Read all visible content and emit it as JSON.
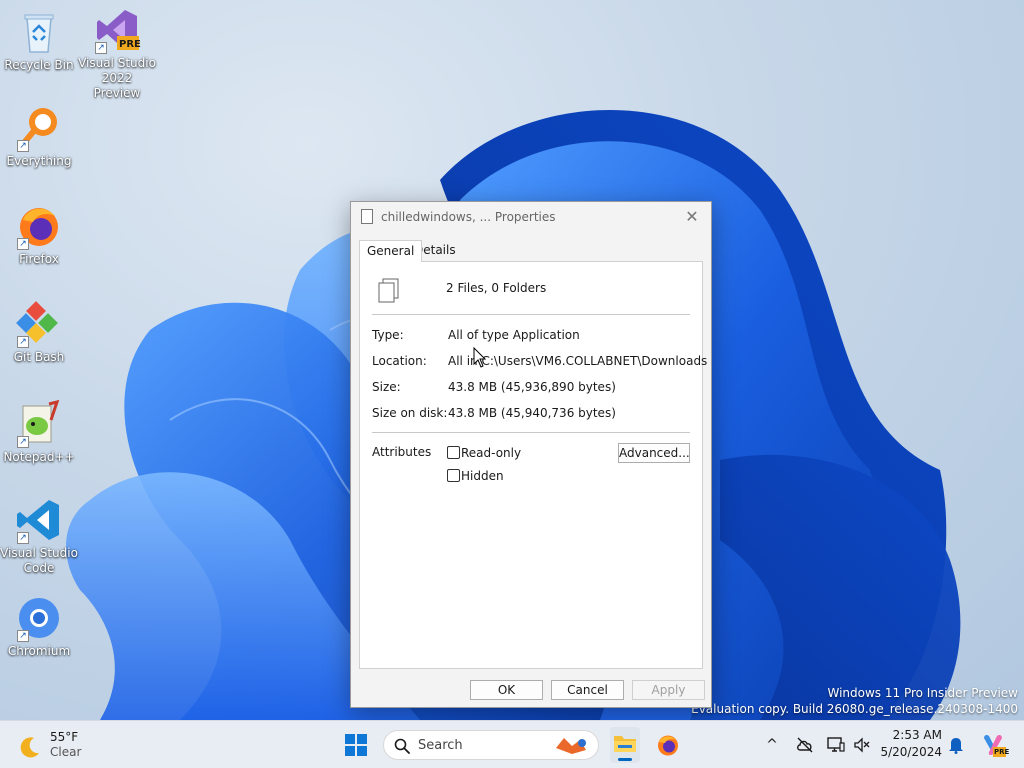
{
  "desktop": {
    "icons": [
      {
        "label": "Recycle Bin"
      },
      {
        "label": "Visual Studio 2022 Preview",
        "badge": "PRE"
      },
      {
        "label": "Everything"
      },
      {
        "label": "Firefox"
      },
      {
        "label": "Git Bash"
      },
      {
        "label": "Notepad++"
      },
      {
        "label": "Visual Studio Code"
      },
      {
        "label": "Chromium"
      }
    ],
    "watermark": {
      "line1": "Windows 11 Pro Insider Preview",
      "line2": "Evaluation copy. Build 26080.ge_release.240308-1400"
    }
  },
  "dialog": {
    "title": "chilledwindows, ... Properties",
    "close_symbol": "✕",
    "tabs": [
      {
        "label": "General"
      },
      {
        "label": "Details"
      }
    ],
    "active_tab": "General",
    "summary": "2 Files, 0 Folders",
    "rows": [
      {
        "label": "Type:",
        "value": "All of type Application"
      },
      {
        "label": "Location:",
        "value": "All in C:\\Users\\VM6.COLLABNET\\Downloads"
      },
      {
        "label": "Size:",
        "value": "43.8 MB (45,936,890 bytes)"
      },
      {
        "label": "Size on disk:",
        "value": "43.8 MB (45,940,736 bytes)"
      }
    ],
    "attributes": {
      "label": "Attributes",
      "readonly_label": "Read-only",
      "readonly_checked": false,
      "hidden_label": "Hidden",
      "hidden_checked": false,
      "advanced_label": "Advanced..."
    },
    "buttons": {
      "ok": "OK",
      "cancel": "Cancel",
      "apply": "Apply"
    }
  },
  "taskbar": {
    "weather": {
      "temp": "55°F",
      "condition": "Clear"
    },
    "search_label": "Search",
    "time": "2:53 AM",
    "date": "5/20/2024",
    "copilot_badge": "PRE"
  },
  "colors": {
    "accent": "#0067c0",
    "wallpaper_bloom": "#1a5fe0"
  }
}
